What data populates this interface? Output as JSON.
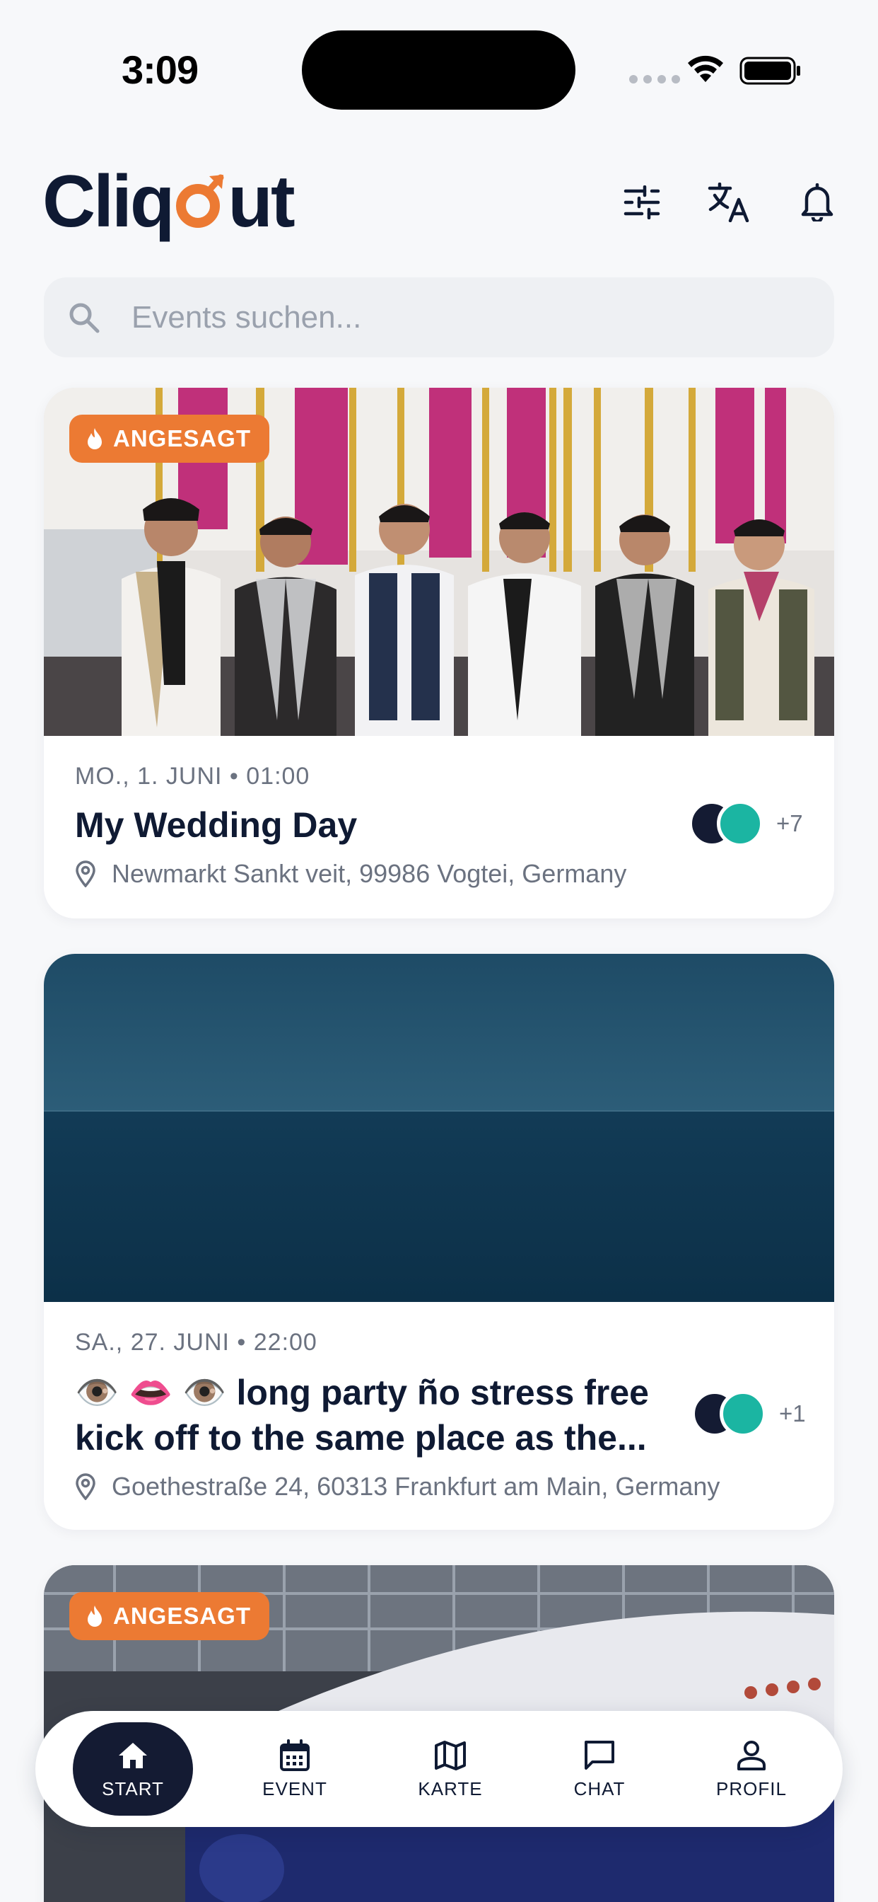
{
  "status_bar": {
    "time": "3:09"
  },
  "app": {
    "logo_text_left": "Cliq",
    "logo_text_right": "ut",
    "brand_color": "#ec7a33",
    "primary_dark": "#141b33"
  },
  "header": {
    "icons": [
      "filter-sliders-icon",
      "translate-icon",
      "bell-icon"
    ]
  },
  "search": {
    "placeholder": "Events suchen...",
    "value": ""
  },
  "events": [
    {
      "badge": "ANGESAGT",
      "date": "MO., 1. JUNI • 01:00",
      "title": "My Wedding Day",
      "location": "Newmarkt Sankt veit, 99986 Vogtei, Germany",
      "attendees_extra": "+7"
    },
    {
      "badge": "",
      "date": "SA., 27. JUNI • 22:00",
      "title_line1": "👁️ 👄 👁️  long  party ño stress free",
      "title_line2": "kick off to the same place as the...",
      "location": "Goethestraße 24, 60313 Frankfurt am Main, Germany",
      "attendees_extra": "+1"
    },
    {
      "badge": "ANGESAGT"
    }
  ],
  "nav": {
    "start": "START",
    "event": "EVENT",
    "karte": "KARTE",
    "chat": "CHAT",
    "profil": "PROFIL",
    "active": "start"
  }
}
